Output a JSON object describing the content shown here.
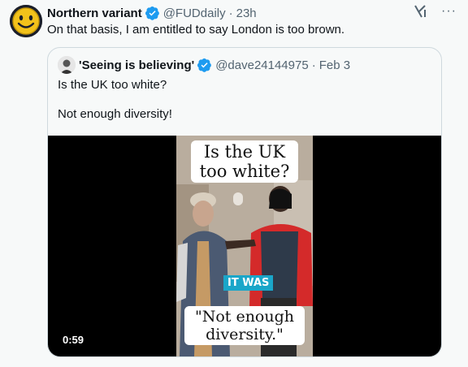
{
  "tweet": {
    "author_name": "Northern variant",
    "handle": "@FUDdaily",
    "time": "23h",
    "text": "On that basis, I am entitled to say London is too brown.",
    "avatar_icon": "smiley-face-icon"
  },
  "quoted": {
    "author_name": "'Seeing is believing'",
    "handle": "@dave24144975",
    "date": "Feb 3",
    "line1": "Is the UK too white?",
    "line2": "Not enough diversity!"
  },
  "video": {
    "caption_top": "Is the UK too white?",
    "overlay_text": "IT WAS",
    "caption_bottom": "\"Not enough diversity.\"",
    "timestamp": "0:59"
  },
  "colors": {
    "verified": "#1d9bf0",
    "muted": "#536471",
    "overlay": "#1aa6c9"
  },
  "icons": {
    "verified": "verified-badge-icon",
    "grok": "grok-icon",
    "more": "more-icon"
  }
}
